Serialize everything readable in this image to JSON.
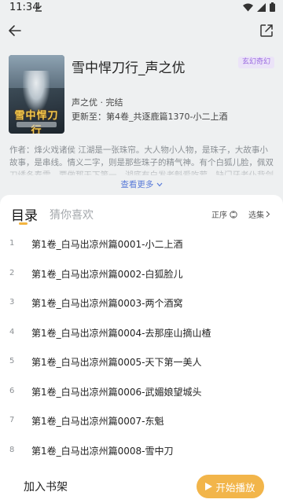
{
  "status": {
    "time": "11:34"
  },
  "book": {
    "title": "雪中悍刀行_声之优",
    "genre": "玄幻奇幻",
    "cover_title": "雪中悍刀行",
    "author_status": "声之优 · 完结",
    "update": "更新至：第4卷_共逐鹿篇1370-小二上酒",
    "intro": "作者：烽火戏诸侯 江湖是一张珠帘。大人物小人物，是珠子，大故事小故事，是串线。情义二字，则是那些珠子的精气神。有个白狐儿脸，佩双刀绣冬春雷，要做那天下第一。湖底有白发老魁爱吃荤。缺门牙老仆背剑匣。山上有个骑青牛的年轻师叔祖，不敢下山。有个骑熊猫扛向日葵不说话的少女。",
    "more_label": "查看更多"
  },
  "tabs": {
    "catalog": "目录",
    "guess": "猜你喜欢"
  },
  "controls": {
    "sort": "正序",
    "select": "选集"
  },
  "chapters": [
    {
      "num": "1",
      "title": "第1卷_白马出凉州篇0001-小二上酒"
    },
    {
      "num": "2",
      "title": "第1卷_白马出凉州篇0002-白狐脸儿"
    },
    {
      "num": "3",
      "title": "第1卷_白马出凉州篇0003-两个酒窝"
    },
    {
      "num": "4",
      "title": "第1卷_白马出凉州篇0004-去那座山摘山楂"
    },
    {
      "num": "5",
      "title": "第1卷_白马出凉州篇0005-天下第一美人"
    },
    {
      "num": "6",
      "title": "第1卷_白马出凉州篇0006-武媚娘望城头"
    },
    {
      "num": "7",
      "title": "第1卷_白马出凉州篇0007-东魁"
    },
    {
      "num": "8",
      "title": "第1卷_白马出凉州篇0008-雪中刀"
    }
  ],
  "bottom": {
    "shelf": "加入书架",
    "play": "开始播放"
  },
  "colors": {
    "accent": "#f2b54a",
    "link": "#5a7bd8",
    "tag": "#9a6ae0",
    "header_bg": "#eef0f1"
  }
}
